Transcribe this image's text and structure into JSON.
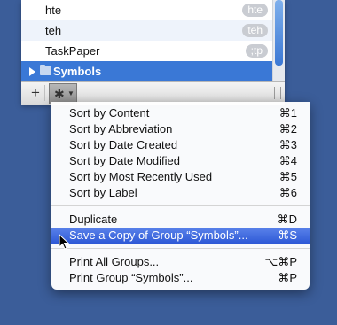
{
  "list": {
    "items": [
      {
        "label": "hte",
        "abbreviation": "hte"
      },
      {
        "label": "teh",
        "abbreviation": "teh"
      },
      {
        "label": "TaskPaper",
        "abbreviation": ";tp"
      },
      {
        "label": "Symbols",
        "abbreviation": ""
      }
    ]
  },
  "toolbar": {
    "add_label": "+"
  },
  "menu": {
    "items": [
      {
        "label": "Sort by Content",
        "shortcut": "⌘1"
      },
      {
        "label": "Sort by Abbreviation",
        "shortcut": "⌘2"
      },
      {
        "label": "Sort by Date Created",
        "shortcut": "⌘3"
      },
      {
        "label": "Sort by Date Modified",
        "shortcut": "⌘4"
      },
      {
        "label": "Sort by Most Recently Used",
        "shortcut": "⌘5"
      },
      {
        "label": "Sort by Label",
        "shortcut": "⌘6"
      },
      {
        "label": "Duplicate",
        "shortcut": "⌘D"
      },
      {
        "label": "Save a Copy of Group “Symbols”...",
        "shortcut": "⌘S"
      },
      {
        "label": "Print All Groups...",
        "shortcut": "⌥⌘P"
      },
      {
        "label": "Print Group “Symbols”...",
        "shortcut": "⌘P"
      }
    ]
  }
}
